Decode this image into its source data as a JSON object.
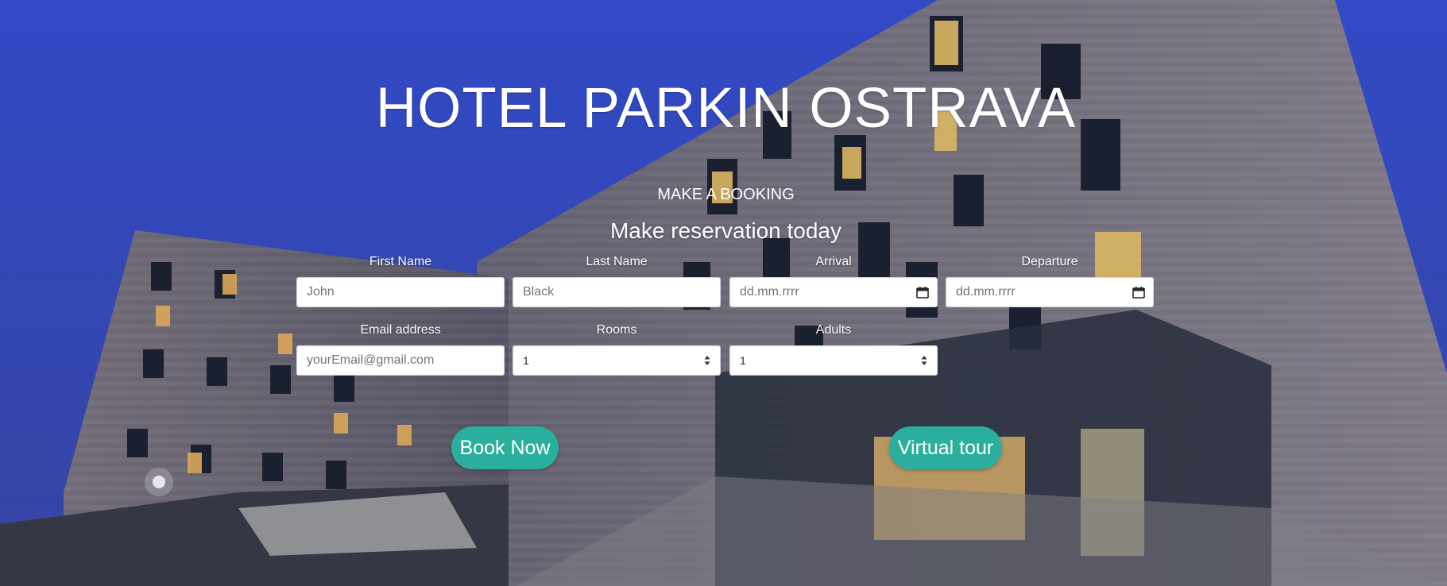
{
  "hero": {
    "title": "HOTEL PARKIN OSTRAVA",
    "subtitle": "MAKE A BOOKING",
    "heading": "Make reservation today"
  },
  "form": {
    "first_name": {
      "label": "First Name",
      "placeholder": "John"
    },
    "last_name": {
      "label": "Last Name",
      "placeholder": "Black"
    },
    "arrival": {
      "label": "Arrival",
      "placeholder": "dd.mm.rrrr"
    },
    "departure": {
      "label": "Departure",
      "placeholder": "dd.mm.rrrr"
    },
    "email": {
      "label": "Email address",
      "placeholder": "yourEmail@gmail.com"
    },
    "rooms": {
      "label": "Rooms",
      "value": "1"
    },
    "adults": {
      "label": "Adults",
      "value": "1"
    }
  },
  "buttons": {
    "book": "Book Now",
    "tour": "Virtual tour"
  },
  "colors": {
    "accent": "#2aaf9e",
    "sky": "#3b4fd0"
  },
  "icons": {
    "date": "calendar-icon",
    "select": "select-arrows-icon"
  }
}
